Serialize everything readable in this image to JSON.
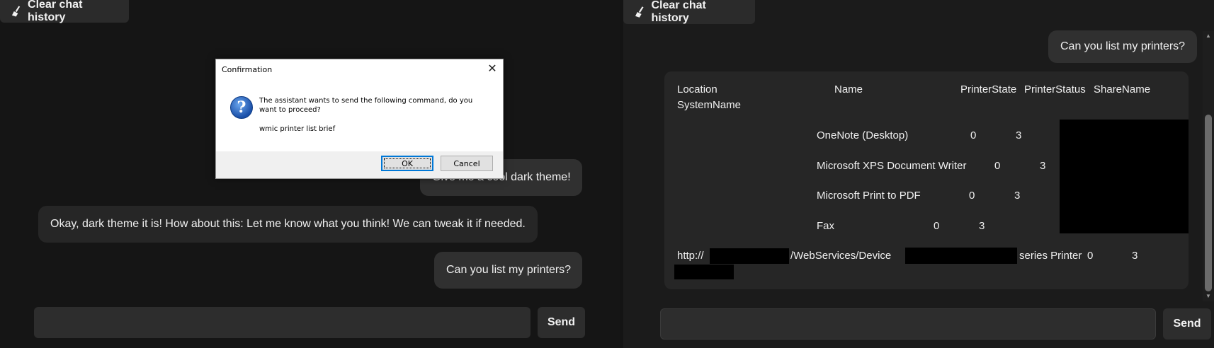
{
  "left": {
    "clear_button": "Clear chat history",
    "messages": [
      {
        "role": "user",
        "text": "Give me a cool dark theme!"
      },
      {
        "role": "assistant",
        "text": "Okay, dark theme it is! How about this: Let me know what you think! We can tweak it if needed."
      },
      {
        "role": "user",
        "text": "Can you list my printers?"
      }
    ],
    "input_value": "",
    "send_label": "Send"
  },
  "dialog": {
    "title": "Confirmation",
    "message": "The assistant wants to send the following command, do you want to proceed?",
    "command": "wmic printer list brief",
    "ok_label": "OK",
    "cancel_label": "Cancel",
    "icon": "question-icon"
  },
  "right": {
    "clear_button": "Clear chat history",
    "user_message": "Can you list my printers?",
    "table": {
      "headers": [
        "Location",
        "Name",
        "PrinterState",
        "PrinterStatus",
        "ShareName",
        "SystemName"
      ],
      "rows": [
        {
          "name": "OneNote (Desktop)",
          "state": "0",
          "status": "3"
        },
        {
          "name": "Microsoft XPS Document Writer",
          "state": "0",
          "status": "3"
        },
        {
          "name": "Microsoft Print to PDF",
          "state": "0",
          "status": "3"
        },
        {
          "name": "Fax",
          "state": "0",
          "status": "3"
        }
      ],
      "network_row": {
        "prefix": "http://",
        "middle": "/WebServices/Device",
        "suffix": "series Printer",
        "state": "0",
        "status": "3"
      }
    },
    "input_value": "",
    "send_label": "Send"
  },
  "colors": {
    "background": "#151515",
    "user_bubble": "#303030",
    "assistant_bubble": "#262626",
    "dialog_accent": "#0078d7"
  }
}
